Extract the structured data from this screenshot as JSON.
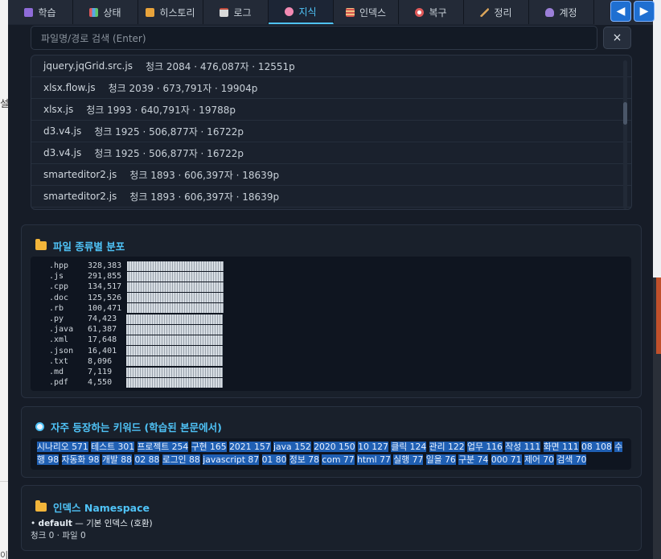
{
  "tabs": [
    {
      "label": "학습",
      "icon": "book-icon",
      "color": "#8e6bd8"
    },
    {
      "label": "상태",
      "icon": "chart-icon",
      "color": "#5aa3e6"
    },
    {
      "label": "히스토리",
      "icon": "scroll-icon",
      "color": "#e8a33b"
    },
    {
      "label": "로그",
      "icon": "clipboard-icon",
      "color": "#d9d9d9"
    },
    {
      "label": "지식",
      "icon": "brain-icon",
      "color": "#f28ab3",
      "active": true
    },
    {
      "label": "인덱스",
      "icon": "index-icon",
      "color": "#d6564e"
    },
    {
      "label": "복구",
      "icon": "lifebuoy-icon",
      "color": "#e05a5a"
    },
    {
      "label": "정리",
      "icon": "broom-icon",
      "color": "#d9a45a"
    },
    {
      "label": "계정",
      "icon": "user-icon",
      "color": "#9b7fd8"
    }
  ],
  "nav": {
    "prev": "◀",
    "next": "▶"
  },
  "search": {
    "placeholder": "파일명/경로 검색 (Enter)",
    "clear_label": "×"
  },
  "results": [
    {
      "name": "jquery.jqGrid.src.js",
      "meta": "청크 2084 · 476,087자 · 12551p"
    },
    {
      "name": "xlsx.flow.js",
      "meta": "청크 2039 · 673,791자 · 19904p"
    },
    {
      "name": "xlsx.js",
      "meta": "청크 1993 · 640,791자 · 19788p"
    },
    {
      "name": "d3.v4.js",
      "meta": "청크 1925 · 506,877자 · 16722p"
    },
    {
      "name": "d3.v4.js",
      "meta": "청크 1925 · 506,877자 · 16722p"
    },
    {
      "name": "smarteditor2.js",
      "meta": "청크 1893 · 606,397자 · 18639p"
    },
    {
      "name": "smarteditor2.js",
      "meta": "청크 1893 · 606,397자 · 18639p"
    }
  ],
  "distribution": {
    "title": "파일 종류별 분포",
    "rows": [
      {
        "ext": ".hpp",
        "count": "328,383",
        "level": 1.0
      },
      {
        "ext": ".js",
        "count": "291,855",
        "level": 1.0
      },
      {
        "ext": ".cpp",
        "count": "134,517",
        "level": 1.0
      },
      {
        "ext": ".doc",
        "count": "125,526",
        "level": 1.0
      },
      {
        "ext": ".rb",
        "count": "100,471",
        "level": 1.0
      },
      {
        "ext": ".py",
        "count": "74,423",
        "level": 1.0
      },
      {
        "ext": ".java",
        "count": "61,387",
        "level": 1.0
      },
      {
        "ext": ".xml",
        "count": "17,648",
        "level": 1.0
      },
      {
        "ext": ".json",
        "count": "16,401",
        "level": 1.0
      },
      {
        "ext": ".txt",
        "count": "8,096",
        "level": 1.0
      },
      {
        "ext": ".md",
        "count": "7,119",
        "level": 1.0
      },
      {
        "ext": ".pdf",
        "count": "4,550",
        "level": 1.0
      }
    ]
  },
  "keywords": {
    "title": "자주 등장하는 키워드 (학습된 본문에서)",
    "items": [
      "시나리오 571",
      "테스트 301",
      "프로젝트 254",
      "구현 165",
      "2021 157",
      "java 152",
      "2020 150",
      "10 127",
      "클릭 124",
      "관리 122",
      "업무 116",
      "작성 111",
      "화면 111",
      "08 108",
      "수행 98",
      "자동화 98",
      "개발 88",
      "02 88",
      "로그인 88",
      "javascript 87",
      "01 80",
      "정보 78",
      "com 77",
      "html 77",
      "실행 77",
      "일을 76",
      "구분 74",
      "000 71",
      "제어 70",
      "검색 70"
    ]
  },
  "namespace": {
    "title": "인덱스 Namespace",
    "bullet": "•",
    "name": "default",
    "desc": "— 기본 인덱스 (호환)",
    "stats": "청크 0 · 파일 0"
  },
  "background": {
    "left_char": "설",
    "left_char2": "이"
  }
}
